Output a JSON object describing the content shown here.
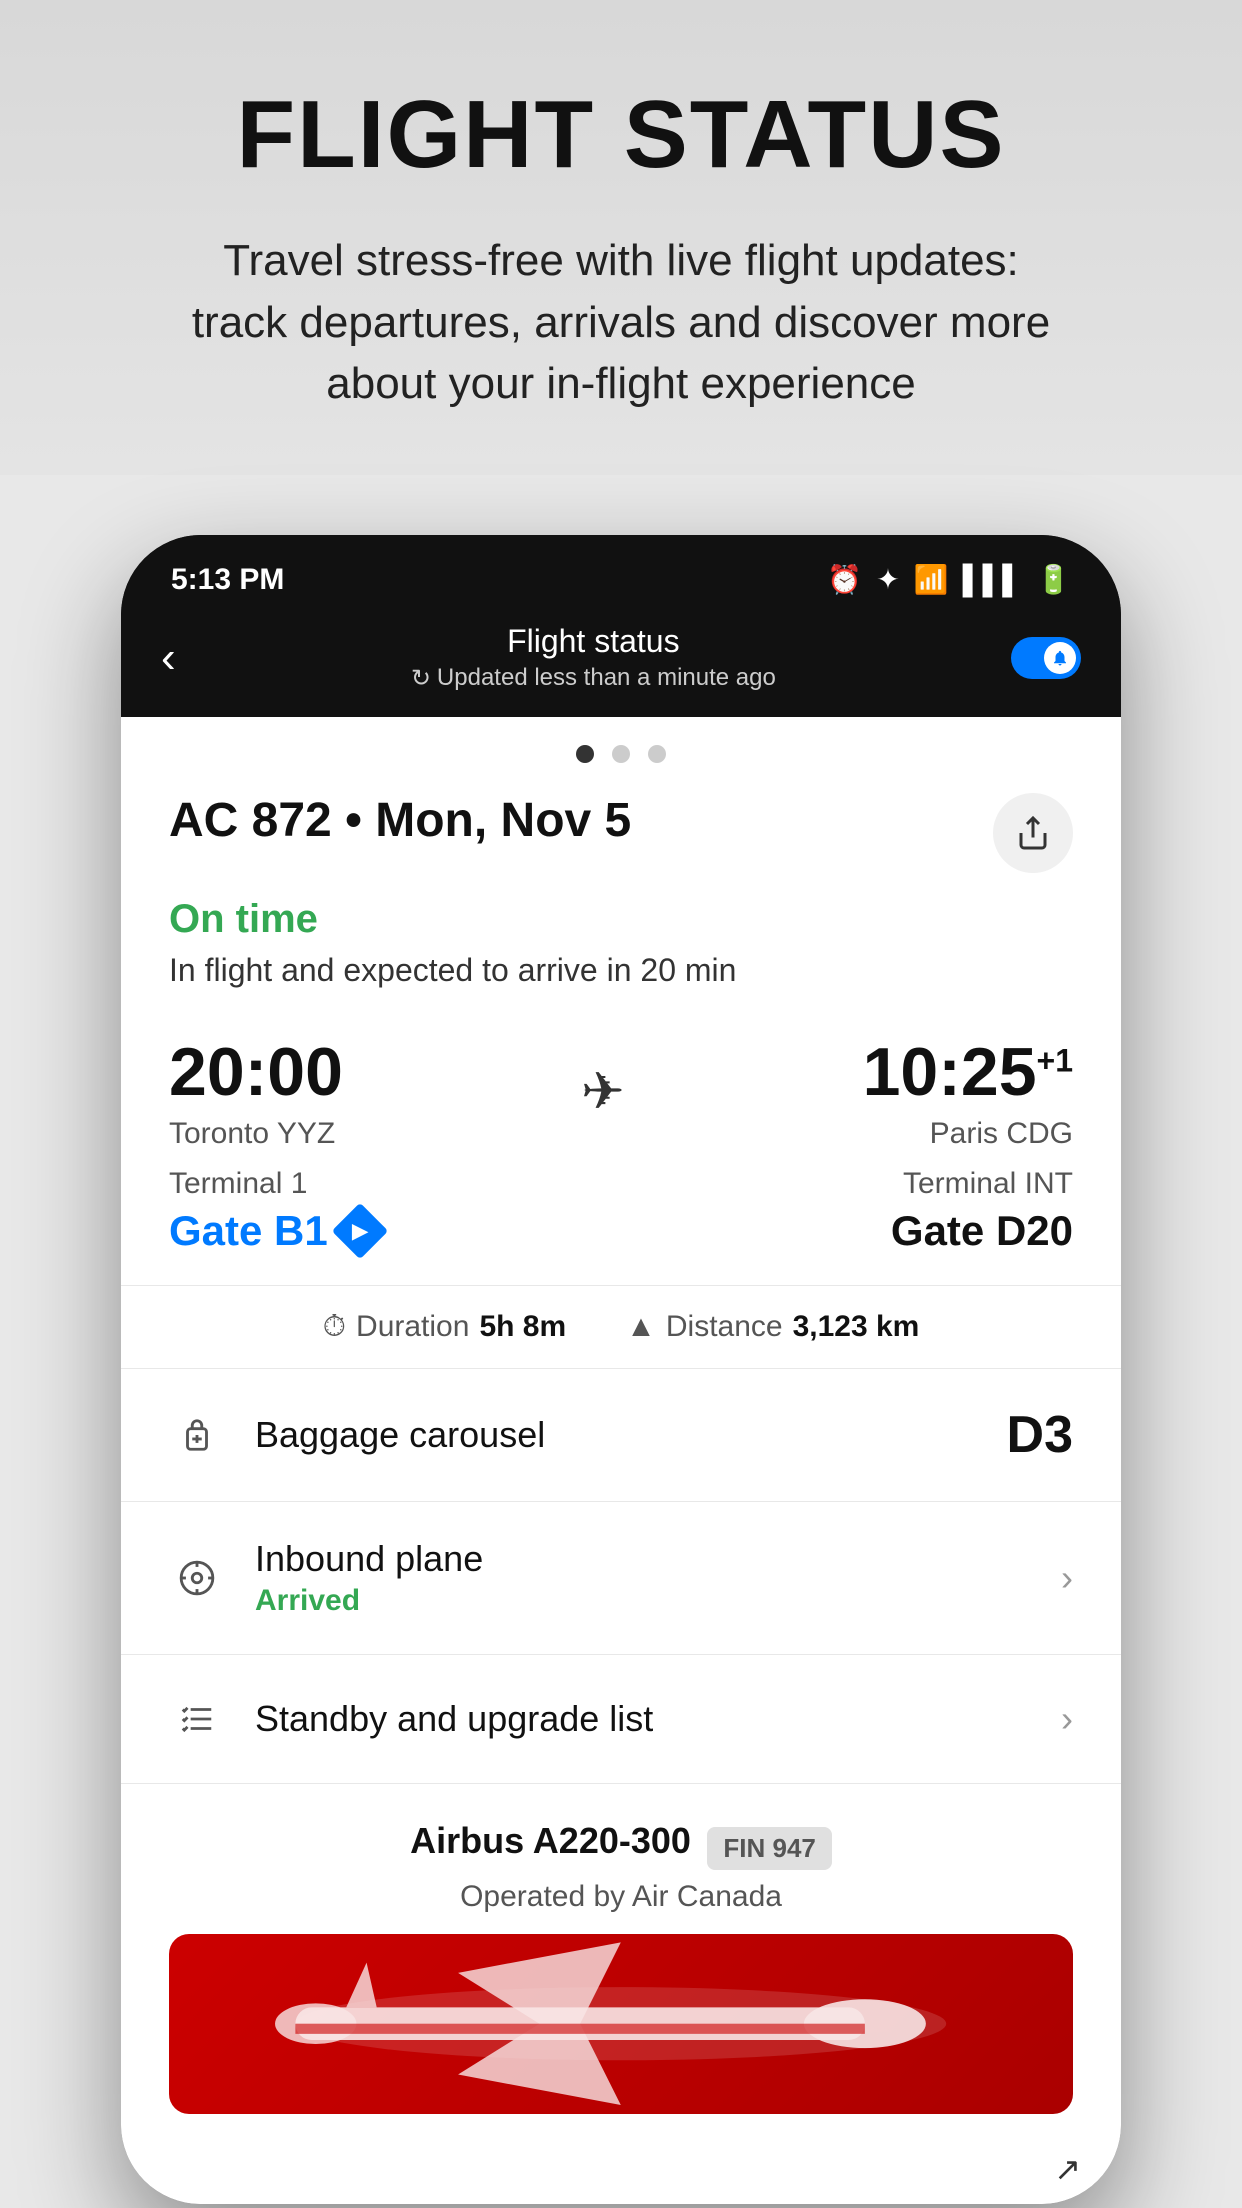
{
  "page": {
    "title": "FLIGHT STATUS",
    "subtitle": "Travel stress-free with live flight updates: track departures, arrivals and discover more about your in-flight experience"
  },
  "phone": {
    "status_bar": {
      "time": "5:13 PM",
      "icons": [
        "alarm",
        "bluetooth",
        "wifi",
        "signal",
        "battery"
      ]
    },
    "nav": {
      "back_label": "‹",
      "title": "Flight status",
      "updated": "Updated less than a minute ago",
      "refresh_icon": "↻"
    },
    "pagination": {
      "dots": [
        true,
        false,
        false
      ]
    },
    "flight": {
      "id": "AC 872 • Mon, Nov 5",
      "status_label": "On time",
      "status_desc": "In flight and expected to arrive in 20 min"
    },
    "route": {
      "departure_time": "20:00",
      "departure_city": "Toronto YYZ",
      "departure_terminal": "Terminal 1",
      "departure_gate": "Gate B1",
      "arrival_time": "10:25",
      "arrival_time_suffix": "+1",
      "arrival_city": "Paris CDG",
      "arrival_terminal": "Terminal INT",
      "arrival_gate": "Gate D20"
    },
    "details": {
      "duration_label": "Duration",
      "duration_value": "5h 8m",
      "distance_label": "Distance",
      "distance_value": "3,123 km"
    },
    "list_items": [
      {
        "icon": "baggage",
        "title": "Baggage carousel",
        "subtitle": null,
        "value": "D3",
        "has_chevron": false
      },
      {
        "icon": "plane-circle",
        "title": "Inbound plane",
        "subtitle": "Arrived",
        "value": null,
        "has_chevron": true
      },
      {
        "icon": "list-check",
        "title": "Standby and upgrade list",
        "subtitle": null,
        "value": null,
        "has_chevron": true
      }
    ],
    "aircraft": {
      "model": "Airbus A220-300",
      "fin": "FIN 947",
      "operator": "Operated by Air Canada"
    }
  }
}
